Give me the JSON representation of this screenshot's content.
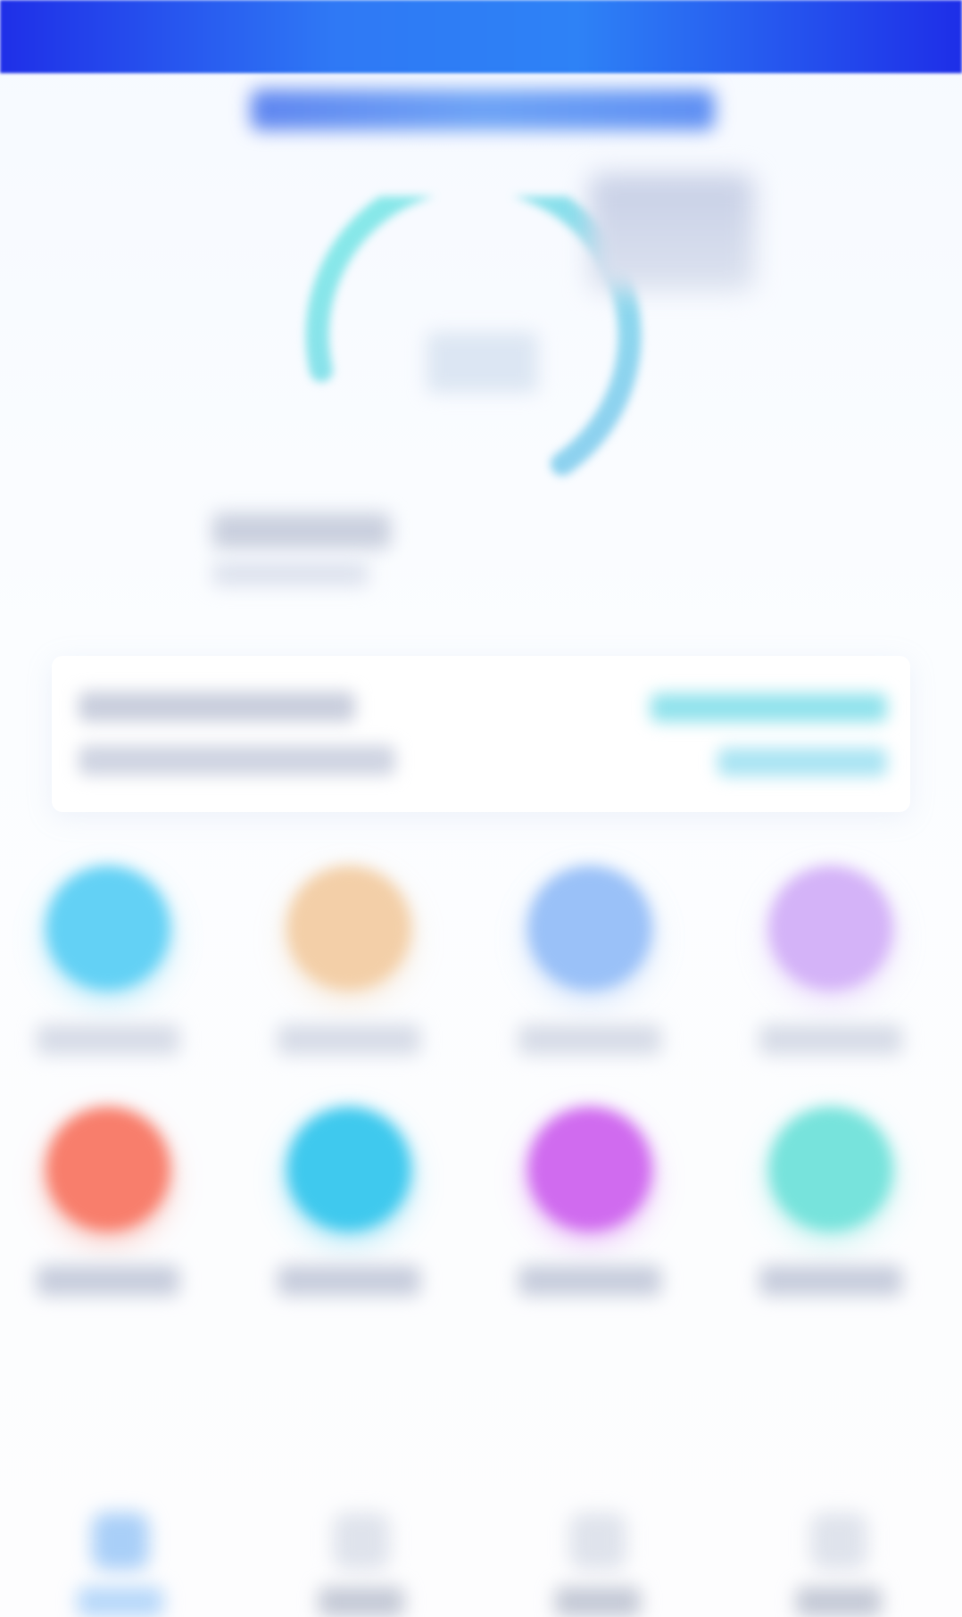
{
  "header": {
    "banner_title": ""
  },
  "gauge": {
    "value_text": "",
    "badge_text": "",
    "left_stat_value": "",
    "left_stat_label": "",
    "track_color": "#7fe0e8",
    "progress_color": "#8fd3ef"
  },
  "info_card": {
    "line1": "",
    "line2": "",
    "link1": "",
    "link2": ""
  },
  "features": [
    {
      "label": "",
      "color": "#63d1f5",
      "icon": "circle-icon"
    },
    {
      "label": "",
      "color": "#f3cfa8",
      "icon": "circle-icon"
    },
    {
      "label": "",
      "color": "#9ac1f8",
      "icon": "circle-icon"
    },
    {
      "label": "",
      "color": "#d4b3f8",
      "icon": "circle-icon"
    },
    {
      "label": "",
      "color": "#f87e6c",
      "icon": "circle-icon"
    },
    {
      "label": "",
      "color": "#3fc9ee",
      "icon": "circle-icon"
    },
    {
      "label": "",
      "color": "#d06bef",
      "icon": "circle-icon"
    },
    {
      "label": "",
      "color": "#77e3dc",
      "icon": "circle-icon"
    }
  ],
  "bottom_nav": [
    {
      "label": "",
      "active": true,
      "icon": "home-icon"
    },
    {
      "label": "",
      "active": false,
      "icon": "grid-icon"
    },
    {
      "label": "",
      "active": false,
      "icon": "message-icon"
    },
    {
      "label": "",
      "active": false,
      "icon": "user-icon"
    }
  ]
}
